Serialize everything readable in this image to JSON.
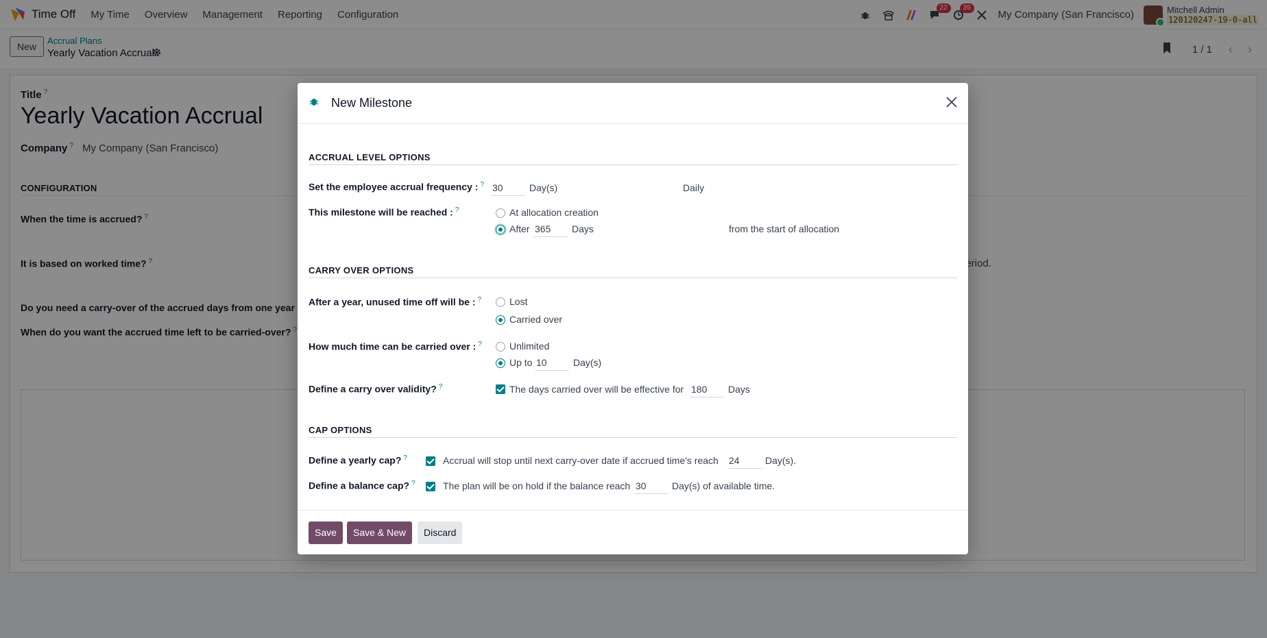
{
  "navbar": {
    "app_name": "Time Off",
    "menu": [
      "My Time",
      "Overview",
      "Management",
      "Reporting",
      "Configuration"
    ],
    "chat_badge": "22",
    "activity_badge": "39",
    "company": "My Company (San Francisco)",
    "user_name": "Mitchell Admin",
    "database": "120120247-19-0-all"
  },
  "control_panel": {
    "new_label": "New",
    "breadcrumb_parent": "Accrual Plans",
    "breadcrumb_current": "Yearly Vacation Accrual",
    "pager_value": "1 / 1"
  },
  "form": {
    "title_label": "Title",
    "title_value": "Yearly Vacation Accrual",
    "company_label": "Company",
    "company_value": "My Company (San Francisco)",
    "section_configuration": "CONFIGURATION",
    "q_accrued": "When the time is accrued?",
    "q_worked_time": "It is based on worked time?",
    "q_carry_over": "Do you need a carry-over of the accrued days from one year to",
    "q_carried_when": "When do you want the accrued time left to be carried-over?",
    "period_fragment": "period."
  },
  "modal": {
    "title": "New Milestone",
    "section_accrual": "ACCRUAL LEVEL OPTIONS",
    "frequency_label": "Set the employee accrual frequency :",
    "frequency_value": "30",
    "frequency_unit": "Day(s)",
    "frequency_type": "Daily",
    "milestone_label": "This milestone will be reached :",
    "option_at_creation": "At allocation creation",
    "option_after": "After",
    "after_value": "365",
    "after_unit": "Days",
    "after_suffix": "from the start of allocation",
    "section_carry": "CARRY OVER OPTIONS",
    "unused_label": "After a year, unused time off will be :",
    "option_lost": "Lost",
    "option_carried": "Carried over",
    "how_much_label": "How much time can be carried over :",
    "option_unlimited": "Unlimited",
    "option_up_to": "Up to",
    "up_to_value": "10",
    "up_to_unit": "Day(s)",
    "validity_label": "Define a carry over validity?",
    "validity_text": "The days carried over will be effective for",
    "validity_value": "180",
    "validity_unit": "Days",
    "section_cap": "CAP OPTIONS",
    "yearly_cap_label": "Define a yearly cap?",
    "yearly_cap_text": "Accrual will stop until next carry-over date if accrued time's reach",
    "yearly_cap_value": "24",
    "yearly_cap_unit": "Day(s).",
    "balance_cap_label": "Define a balance cap?",
    "balance_cap_text": "The plan will be on hold if the balance reach",
    "balance_cap_value": "30",
    "balance_cap_unit": "Day(s) of available time.",
    "save_label": "Save",
    "save_new_label": "Save & New",
    "discard_label": "Discard"
  },
  "help_mark": "?",
  "colors": {
    "primary": "#714b67",
    "accent": "#017e84",
    "badge": "#dc3545"
  }
}
